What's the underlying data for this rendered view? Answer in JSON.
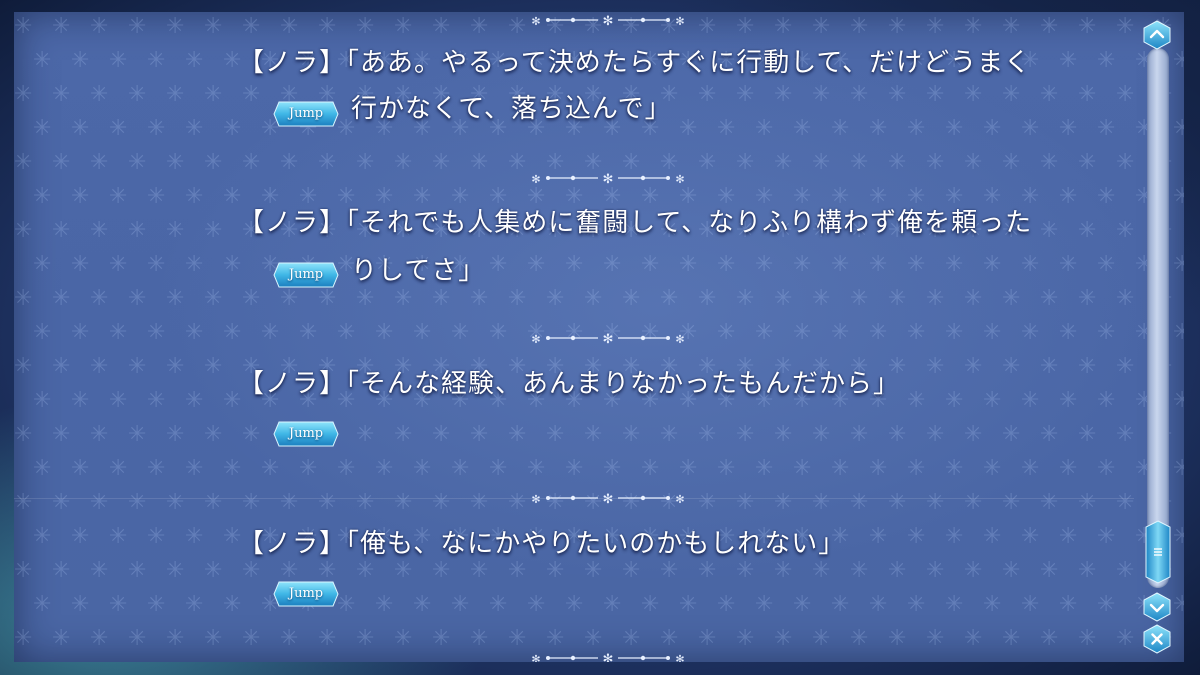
{
  "backlog": {
    "entries": [
      {
        "speaker": "【ノラ】",
        "line1": "「ああ。やるって決めたらすぐに行動して、だけどうまく",
        "line2": "行かなくて、落ち込んで」",
        "jump_label": "Jump"
      },
      {
        "speaker": "【ノラ】",
        "line1": "「それでも人集めに奮闘して、なりふり構わず俺を頼った",
        "line2": "りしてさ」",
        "jump_label": "Jump"
      },
      {
        "speaker": "【ノラ】",
        "line1": "「そんな経験、あんまりなかったもんだから」",
        "line2": "",
        "jump_label": "Jump"
      },
      {
        "speaker": "【ノラ】",
        "line1": "「俺も、なにかやりたいのかもしれない」",
        "line2": "",
        "jump_label": "Jump"
      }
    ]
  },
  "scrollbar": {
    "position": 0.92,
    "up_icon": "chevron-up-icon",
    "down_icon": "chevron-down-icon",
    "thumb_icon": "grip-lines-icon",
    "close_icon": "close-icon"
  },
  "colors": {
    "panel": "#4a66a6",
    "text": "#ffffff",
    "button": "#3fb6e6",
    "accent": "#7fd8f5"
  }
}
